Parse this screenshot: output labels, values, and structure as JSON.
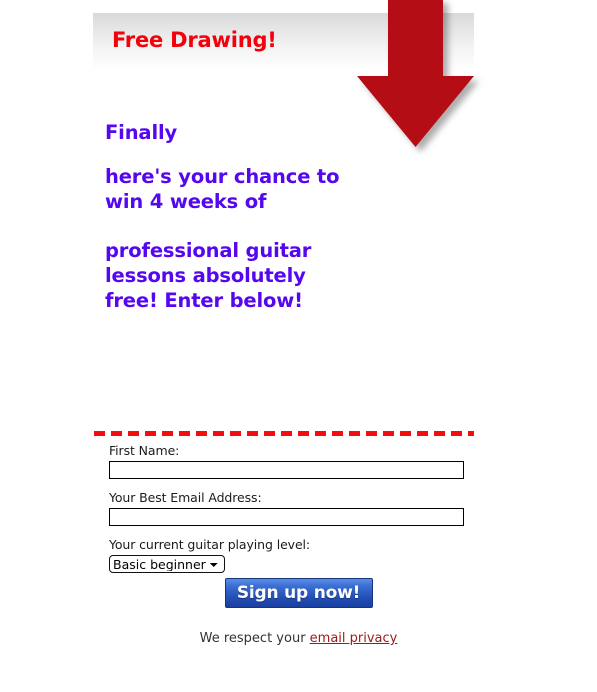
{
  "header": {
    "headline": "Free Drawing!",
    "band_color": "#d9d9d9",
    "headline_color": "#f4000b"
  },
  "arrow": {
    "icon": "arrow-down-icon",
    "color": "#b50d12",
    "shadow_color": "rgba(0,0,0,0.30)"
  },
  "promo": {
    "accent_color": "#5507ef",
    "line_1": "Finally",
    "line_2": "here's your chance to win 4 weeks of",
    "line_3": "professional guitar lessons absolutely free! Enter below!"
  },
  "divider": {
    "style": "dashed",
    "color": "#f50d0d"
  },
  "form": {
    "first_name": {
      "label": "First Name:",
      "value": "",
      "placeholder": ""
    },
    "email": {
      "label": "Your Best Email Address:",
      "value": "",
      "placeholder": ""
    },
    "level": {
      "label": "Your current guitar playing level:",
      "selected": "Basic beginner",
      "options": [
        "Basic beginner"
      ]
    },
    "submit_label": "Sign up now!",
    "submit_color": "#2a59bf"
  },
  "footer": {
    "respect_text": "We respect your ",
    "privacy_link": "email privacy",
    "link_color": "#9a1b1b"
  }
}
